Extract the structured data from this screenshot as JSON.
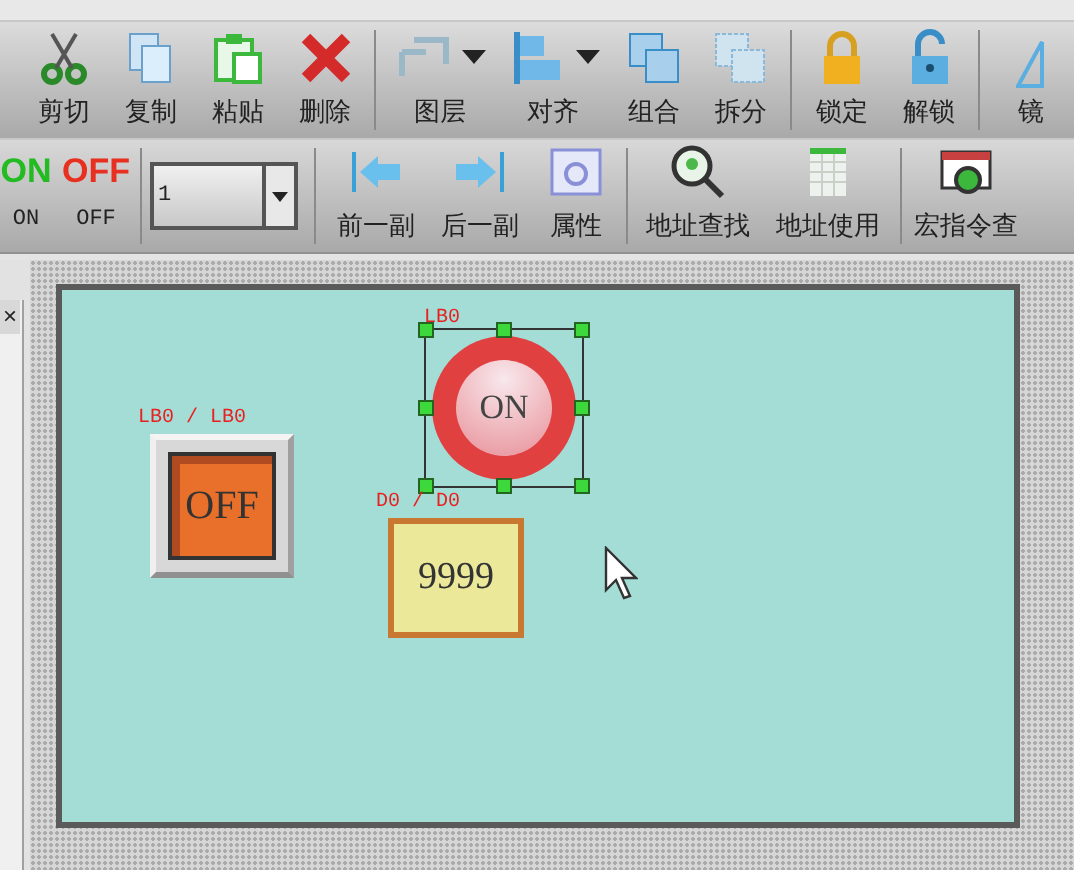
{
  "toolbar": [
    {
      "label": "剪切",
      "dropdown": false
    },
    {
      "label": "复制",
      "dropdown": false
    },
    {
      "label": "粘贴",
      "dropdown": false
    },
    {
      "label": "删除",
      "dropdown": false
    },
    {
      "label": "图层",
      "dropdown": true
    },
    {
      "label": "对齐",
      "dropdown": true
    },
    {
      "label": "组合",
      "dropdown": false
    },
    {
      "label": "拆分",
      "dropdown": false
    },
    {
      "label": "锁定",
      "dropdown": false
    },
    {
      "label": "解锁",
      "dropdown": false
    },
    {
      "label": "镜",
      "dropdown": false
    }
  ],
  "toolbar_2": {
    "state_buttons": [
      {
        "glyph": "ON",
        "label": "ON",
        "color": "#22bb22"
      },
      {
        "glyph": "OFF",
        "label": "OFF",
        "color": "#e83020"
      }
    ],
    "state_select": {
      "value": "1"
    },
    "buttons": [
      {
        "label": "前一副"
      },
      {
        "label": "后一副"
      },
      {
        "label": "属性"
      },
      {
        "label": "地址查找"
      },
      {
        "label": "地址使用"
      },
      {
        "label": "宏指令查"
      }
    ]
  },
  "panel": {
    "close": "×"
  },
  "canvas": {
    "objects": [
      {
        "kind": "toggle",
        "address": "LB0 / LB0",
        "text": "OFF",
        "selected": false
      },
      {
        "kind": "lamp",
        "address": "LB0",
        "text": "ON",
        "selected": true
      },
      {
        "kind": "numeric",
        "address": "D0 / D0",
        "text": "9999",
        "selected": false
      }
    ]
  }
}
